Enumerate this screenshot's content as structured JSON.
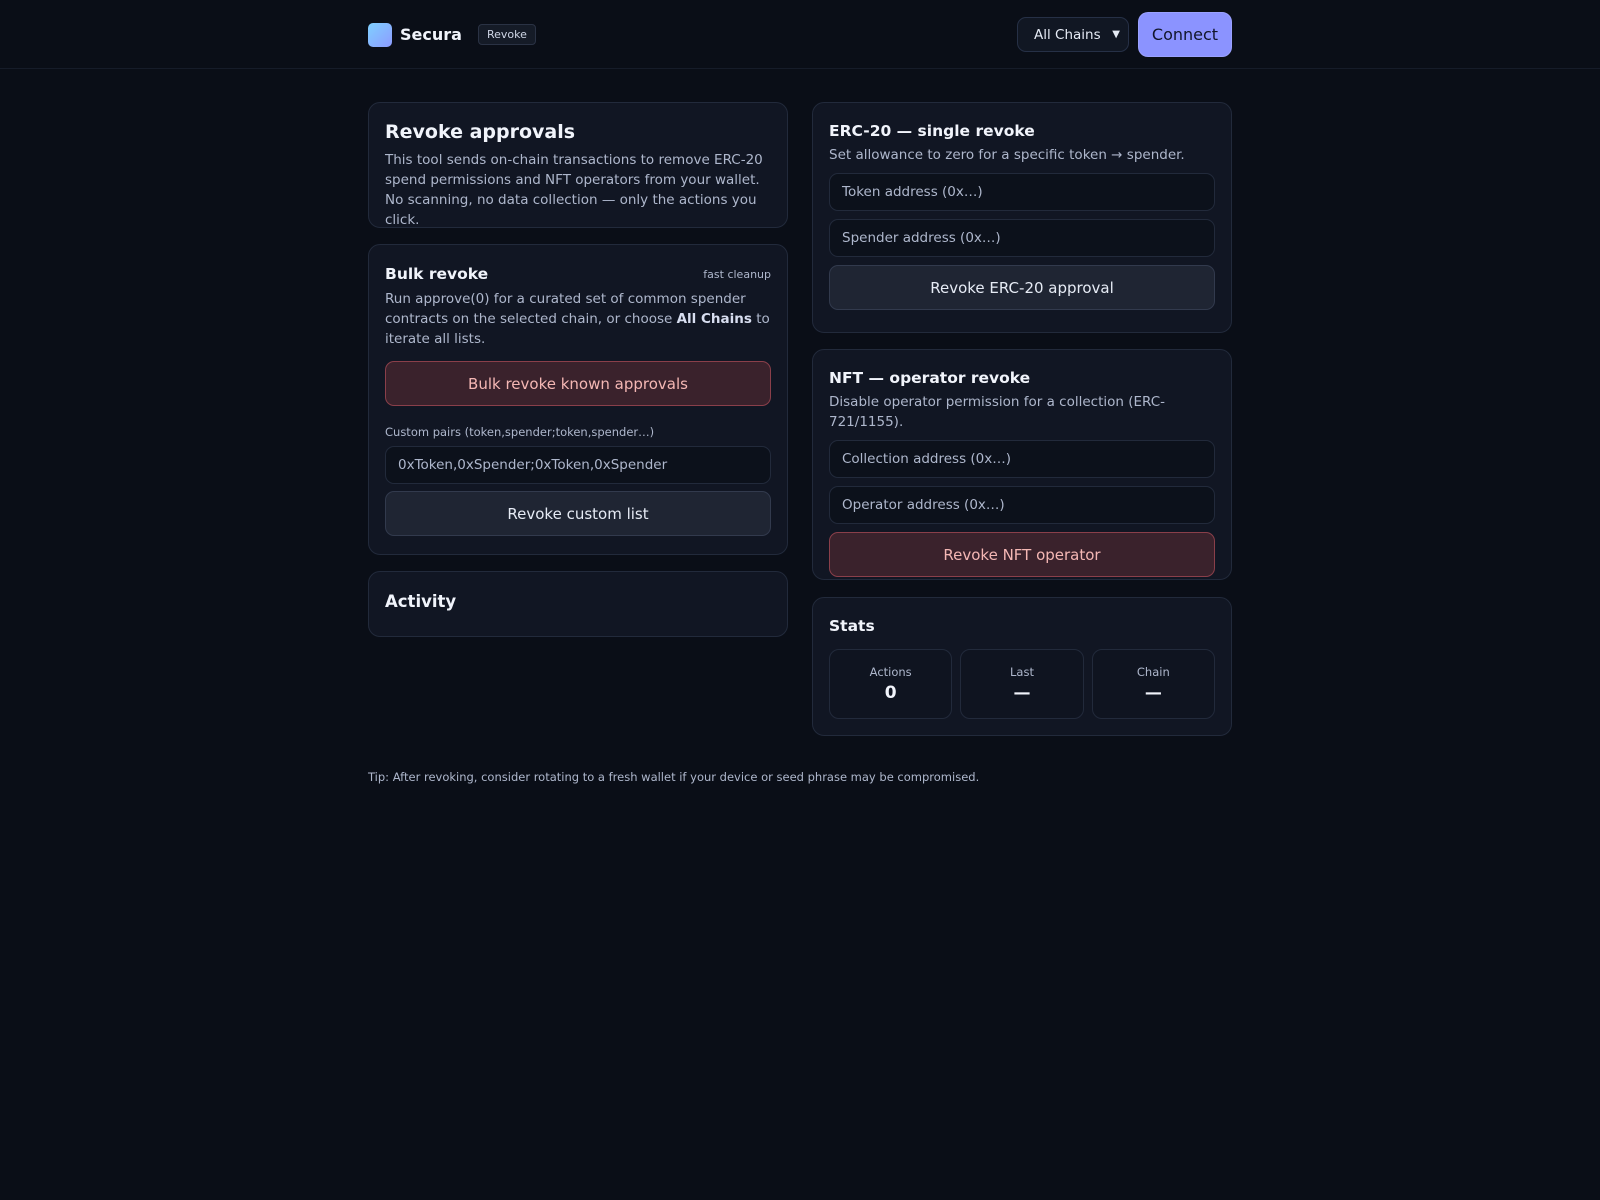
{
  "header": {
    "brand": "Secura",
    "badge": "Revoke",
    "chain_select": "All Chains",
    "connect_label": "Connect"
  },
  "intro": {
    "title": "Revoke approvals",
    "description": "This tool sends on-chain transactions to remove ERC-20 spend permissions and NFT operators from your wallet. No scanning, no data collection — only the actions you click."
  },
  "bulk": {
    "title": "Bulk revoke",
    "tag": "fast cleanup",
    "desc_before": "Run approve(0) for a curated set of common spender contracts on the selected chain, or choose ",
    "desc_bold": "All Chains",
    "desc_after": " to iterate all lists.",
    "bulk_button": "Bulk revoke known approvals",
    "custom_label": "Custom pairs (token,spender;token,spender…)",
    "custom_placeholder": "0xToken,0xSpender;0xToken,0xSpender",
    "custom_button": "Revoke custom list"
  },
  "activity": {
    "title": "Activity"
  },
  "erc20": {
    "title": "ERC-20 — single revoke",
    "description": "Set allowance to zero for a specific token → spender.",
    "token_placeholder": "Token address (0x…)",
    "spender_placeholder": "Spender address (0x…)",
    "button": "Revoke ERC-20 approval"
  },
  "nft": {
    "title": "NFT — operator revoke",
    "description": "Disable operator permission for a collection (ERC-721/1155).",
    "collection_placeholder": "Collection address (0x…)",
    "operator_placeholder": "Operator address (0x…)",
    "button": "Revoke NFT operator"
  },
  "stats": {
    "title": "Stats",
    "items": [
      {
        "label": "Actions",
        "value": "0"
      },
      {
        "label": "Last",
        "value": "—"
      },
      {
        "label": "Chain",
        "value": "—"
      }
    ]
  },
  "footer": {
    "tip": "Tip: After revoking, consider rotating to a fresh wallet if your device or seed phrase may be compromised."
  },
  "colors": {
    "background": "#0a0e17",
    "accent": "#8b93ff",
    "danger": "#8a3f4a"
  }
}
